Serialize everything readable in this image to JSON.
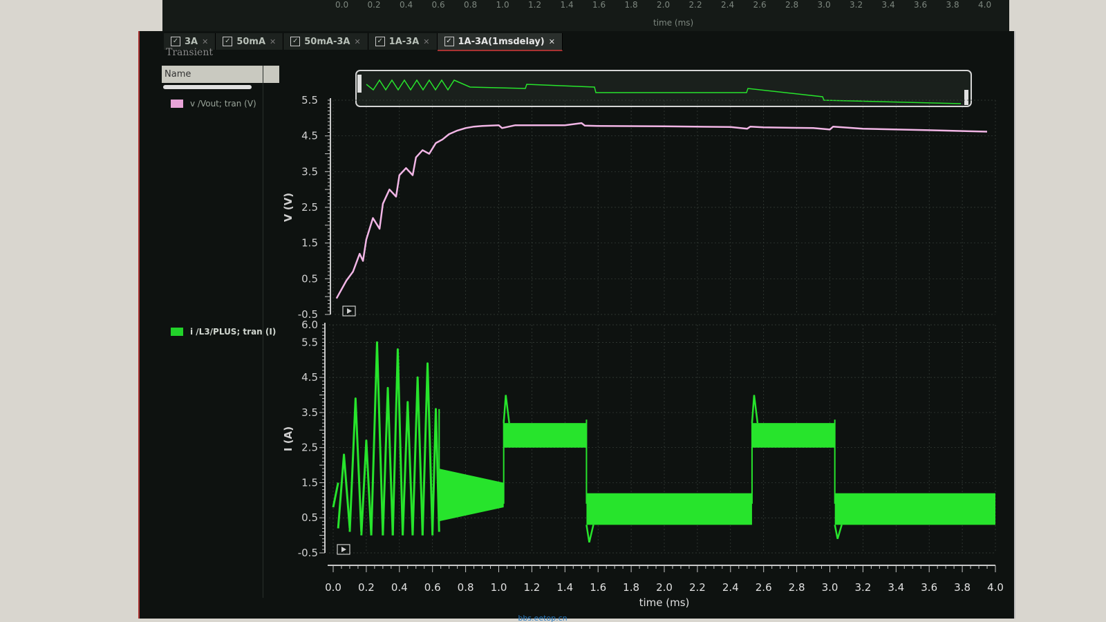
{
  "top_strip": {
    "ticks": [
      "0.0",
      "0.2",
      "0.4",
      "0.6",
      "0.8",
      "1.0",
      "1.2",
      "1.4",
      "1.6",
      "1.8",
      "2.0",
      "2.2",
      "2.4",
      "2.6",
      "2.8",
      "3.0",
      "3.2",
      "3.4",
      "3.6",
      "3.8",
      "4.0"
    ],
    "xlabel": "time (ms)"
  },
  "tabs": [
    {
      "label": "3A",
      "active": false
    },
    {
      "label": "50mA",
      "active": false
    },
    {
      "label": "50mA-3A",
      "active": false
    },
    {
      "label": "1A-3A",
      "active": false
    },
    {
      "label": "1A-3A(1msdelay)",
      "active": true
    }
  ],
  "panel_title": "Transient",
  "name_header": "Name",
  "legend": [
    {
      "label": "v /Vout; tran (V)",
      "color": "#e8a3d8"
    },
    {
      "label": "i /L3/PLUS; tran (I)",
      "color": "#22d22a"
    }
  ],
  "watermark": "bbs.eetop.cn",
  "colors": {
    "voltage": "#f2b6e6",
    "current": "#27e42c",
    "grid": "#3a423c",
    "axis": "#c8c8c8",
    "background": "#0e1210"
  },
  "chart_data": {
    "type": "line",
    "xlabel": "time (ms)",
    "xlim": [
      0.0,
      4.0
    ],
    "x_ticks": [
      "0.0",
      "0.2",
      "0.4",
      "0.6",
      "0.8",
      "1.0",
      "1.2",
      "1.4",
      "1.6",
      "1.8",
      "2.0",
      "2.2",
      "2.4",
      "2.6",
      "2.8",
      "3.0",
      "3.2",
      "3.4",
      "3.6",
      "3.8",
      "4.0"
    ],
    "panels": [
      {
        "ylabel": "V (V)",
        "ylim": [
          -0.5,
          5.5
        ],
        "y_ticks": [
          "5.5",
          "4.5",
          "3.5",
          "2.5",
          "1.5",
          "0.5",
          "-0.5"
        ],
        "series": [
          {
            "name": "v /Vout; tran (V)",
            "x": [
              0.02,
              0.08,
              0.12,
              0.16,
              0.18,
              0.2,
              0.24,
              0.28,
              0.3,
              0.34,
              0.38,
              0.4,
              0.44,
              0.48,
              0.5,
              0.54,
              0.58,
              0.62,
              0.66,
              0.7,
              0.75,
              0.8,
              0.85,
              0.9,
              0.95,
              1.0,
              1.02,
              1.1,
              1.2,
              1.4,
              1.5,
              1.52,
              1.6,
              2.0,
              2.4,
              2.5,
              2.52,
              2.6,
              2.9,
              3.0,
              3.02,
              3.2,
              3.6,
              3.95
            ],
            "y": [
              -0.05,
              0.45,
              0.7,
              1.2,
              1.0,
              1.6,
              2.2,
              1.9,
              2.6,
              3.0,
              2.8,
              3.4,
              3.6,
              3.4,
              3.9,
              4.1,
              4.0,
              4.3,
              4.4,
              4.55,
              4.65,
              4.72,
              4.76,
              4.78,
              4.79,
              4.8,
              4.72,
              4.8,
              4.8,
              4.8,
              4.86,
              4.79,
              4.78,
              4.77,
              4.75,
              4.7,
              4.76,
              4.74,
              4.72,
              4.68,
              4.76,
              4.7,
              4.66,
              4.62
            ]
          }
        ]
      },
      {
        "ylabel": "I (A)",
        "ylim": [
          -0.5,
          6.0
        ],
        "y_ticks": [
          "6.0",
          "5.5",
          "4.5",
          "3.5",
          "2.5",
          "1.5",
          "0.5",
          "-0.5"
        ],
        "series": [
          {
            "name": "i /L3/PLUS; tran (I)",
            "segments": [
              {
                "x0": 0.0,
                "x1": 0.03,
                "low": 0.8,
                "high": 1.5,
                "kind": "ramp"
              },
              {
                "x0": 0.03,
                "x1": 0.1,
                "low": 0.2,
                "high": 2.3,
                "kind": "peak"
              },
              {
                "x0": 0.1,
                "x1": 0.17,
                "low": 0.1,
                "high": 3.9,
                "kind": "peak"
              },
              {
                "x0": 0.17,
                "x1": 0.23,
                "low": 0.0,
                "high": 2.7,
                "kind": "peak"
              },
              {
                "x0": 0.23,
                "x1": 0.3,
                "low": 0.0,
                "high": 5.5,
                "kind": "peak"
              },
              {
                "x0": 0.3,
                "x1": 0.36,
                "low": 0.0,
                "high": 4.2,
                "kind": "peak"
              },
              {
                "x0": 0.36,
                "x1": 0.42,
                "low": 0.0,
                "high": 5.3,
                "kind": "peak"
              },
              {
                "x0": 0.42,
                "x1": 0.48,
                "low": 0.0,
                "high": 3.8,
                "kind": "peak"
              },
              {
                "x0": 0.48,
                "x1": 0.54,
                "low": 0.0,
                "high": 4.5,
                "kind": "peak"
              },
              {
                "x0": 0.54,
                "x1": 0.6,
                "low": 0.0,
                "high": 4.9,
                "kind": "peak"
              },
              {
                "x0": 0.6,
                "x1": 0.64,
                "low": 0.1,
                "high": 3.6,
                "kind": "peak"
              },
              {
                "x0": 0.64,
                "x1": 1.03,
                "low_start": 0.4,
                "low_end": 0.8,
                "high_start": 1.9,
                "high_end": 1.5,
                "kind": "band"
              },
              {
                "x0": 1.03,
                "x1": 1.53,
                "low": 2.5,
                "high": 3.2,
                "spike": 4.0,
                "kind": "band_flat"
              },
              {
                "x0": 1.53,
                "x1": 2.53,
                "low": 0.3,
                "high": 1.2,
                "dip": -0.2,
                "kind": "band_flat"
              },
              {
                "x0": 2.53,
                "x1": 3.03,
                "low": 2.5,
                "high": 3.2,
                "spike": 4.0,
                "kind": "band_flat"
              },
              {
                "x0": 3.03,
                "x1": 4.0,
                "low": 0.3,
                "high": 1.2,
                "dip": -0.1,
                "kind": "band_flat"
              }
            ]
          }
        ]
      }
    ],
    "overview": {
      "color": "#27e42c"
    },
    "grid": true
  }
}
